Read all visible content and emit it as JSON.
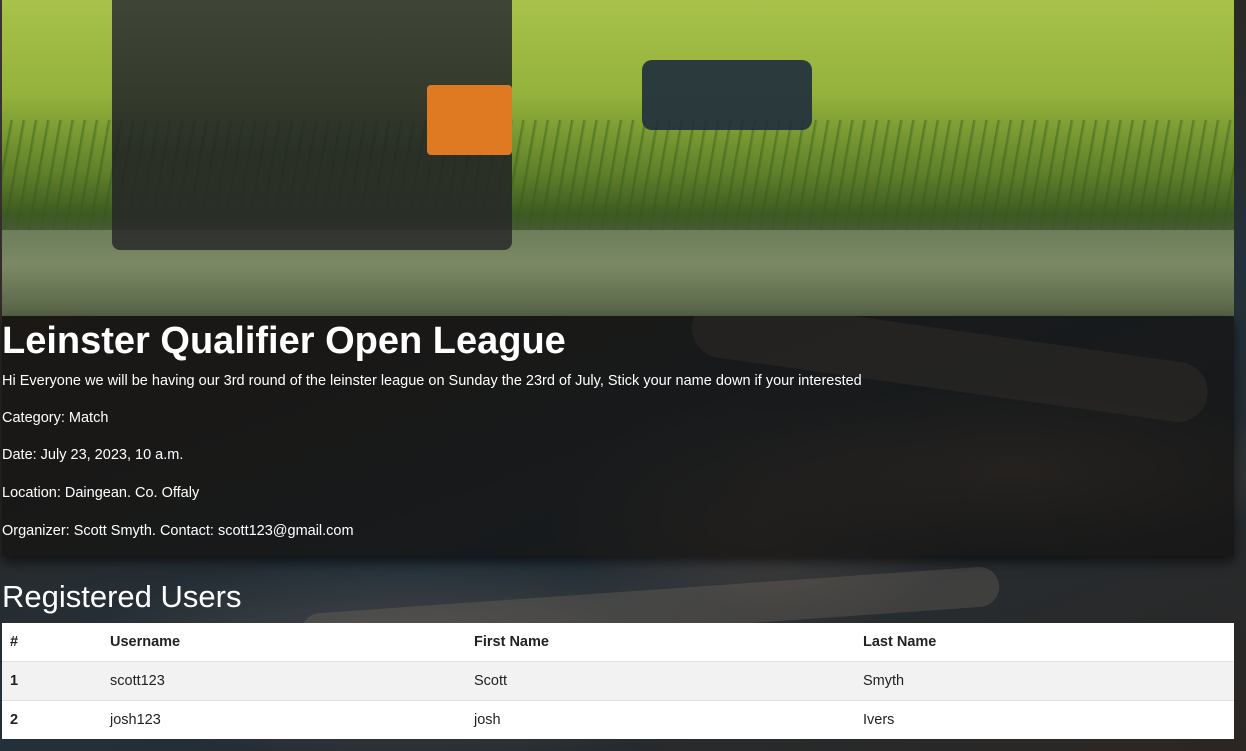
{
  "event": {
    "title": "Leinster Qualifier Open League",
    "description": "Hi Everyone we will be having our 3rd round of the leinster league on Sunday the 23rd of July, Stick your name down if your interested",
    "category": "Category: Match",
    "date": "Date: July 23, 2023, 10 a.m.",
    "location": "Location: Daingean. Co. Offaly",
    "organizer": "Organizer: Scott Smyth. Contact: scott123@gmail.com"
  },
  "registered": {
    "heading": "Registered Users",
    "columns": [
      "#",
      "Username",
      "First Name",
      "Last Name"
    ],
    "rows": [
      {
        "num": "1",
        "username": "scott123",
        "first_name": "Scott",
        "last_name": "Smyth"
      },
      {
        "num": "2",
        "username": "josh123",
        "first_name": "josh",
        "last_name": "Ivers"
      }
    ]
  },
  "colors": {
    "card_overlay": "#141210",
    "table_stripe": "#f2f2f2",
    "text_light": "#ffffff"
  }
}
